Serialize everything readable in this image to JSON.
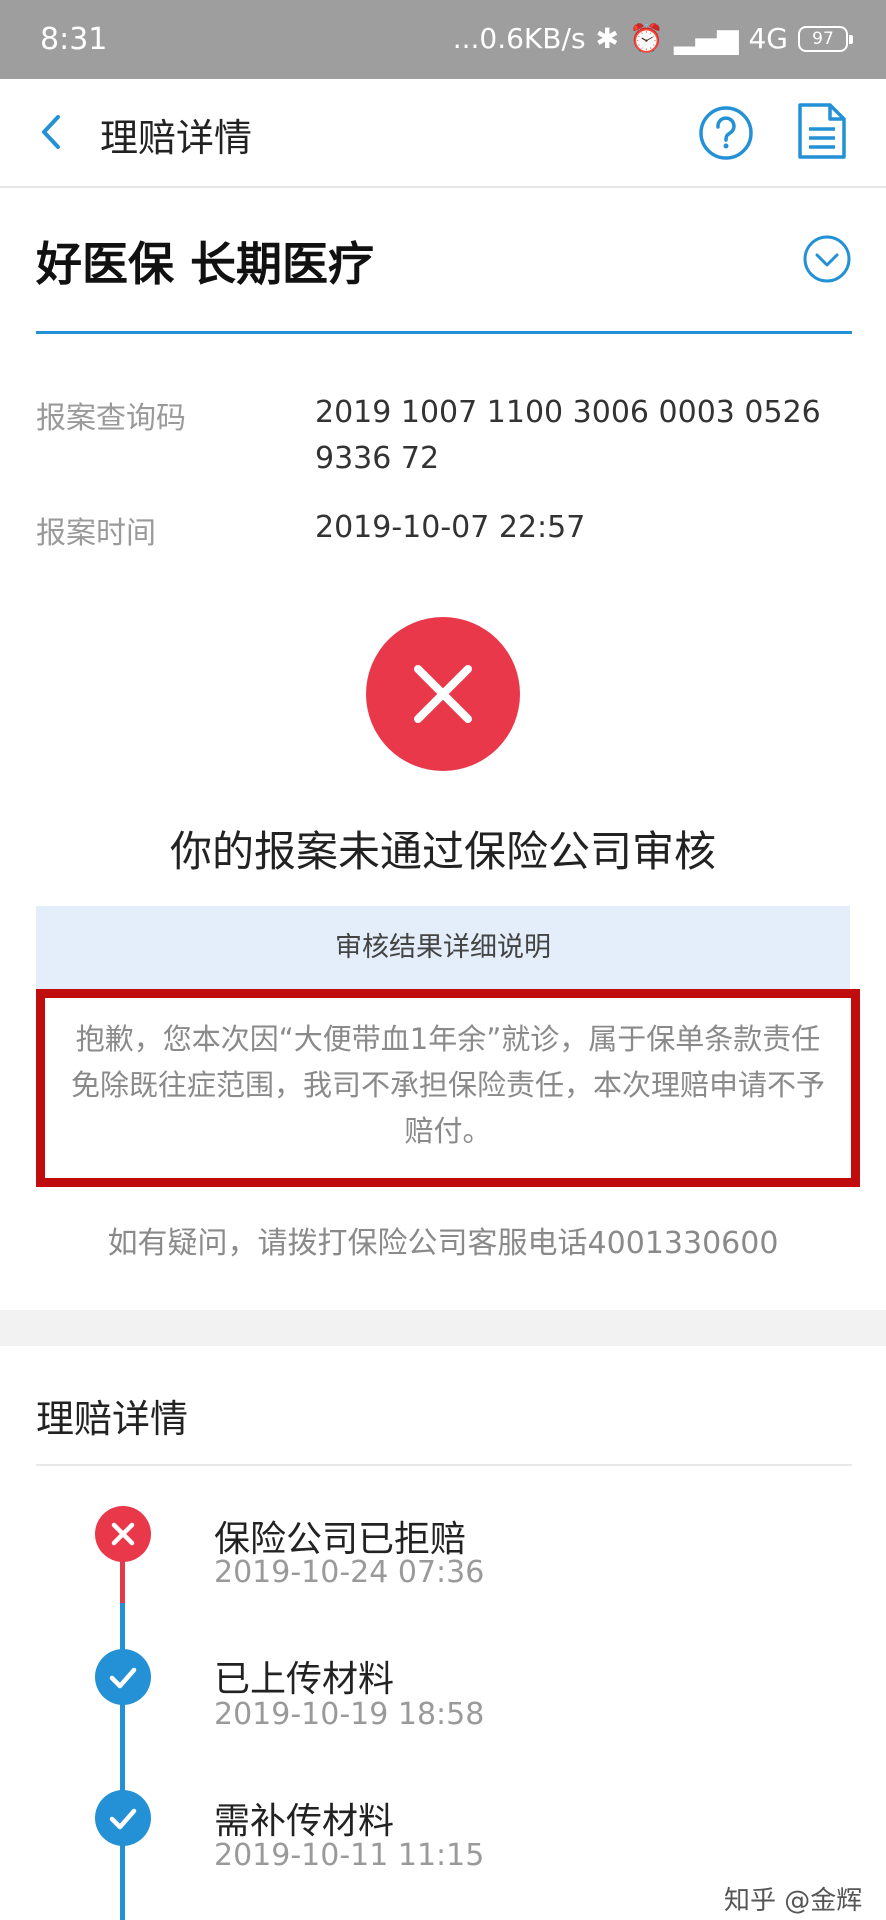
{
  "status_bar": {
    "time": "8:31",
    "network_speed": "...0.6KB/s",
    "network_type": "4G",
    "battery": "97"
  },
  "nav": {
    "title": "理赔详情"
  },
  "product": {
    "name": "好医保 长期医疗"
  },
  "report": {
    "code_label": "报案查询码",
    "code_value": "2019 1007 1100 3006 0003 0526 9336 72",
    "time_label": "报案时间",
    "time_value": "2019-10-07 22:57"
  },
  "result": {
    "title": "你的报案未通过保险公司审核",
    "detail_heading": "审核结果详细说明",
    "detail_text": "抱歉，您本次因“大便带血1年余”就诊，属于保单条款责任免除既往症范围，我司不承担保险责任，本次理赔申请不予赔付。",
    "hotline": "如有疑问，请拨打保险公司客服电话4001330600"
  },
  "claim_details": {
    "title": "理赔详情",
    "steps": [
      {
        "title": "保险公司已拒赔",
        "time": "2019-10-24 07:36",
        "status": "rejected"
      },
      {
        "title": "已上传材料",
        "time": "2019-10-19 18:58",
        "status": "done"
      },
      {
        "title": "需补传材料",
        "time": "2019-10-11 11:15",
        "status": "done"
      }
    ]
  },
  "colors": {
    "accent": "#2491d6",
    "reject_red": "#e8384a",
    "highlight_border": "#c00c0c"
  },
  "watermark": "知乎 @金辉"
}
